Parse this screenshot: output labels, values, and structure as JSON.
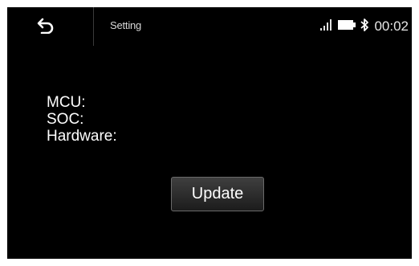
{
  "header": {
    "title": "Setting",
    "back_icon": "back-arrow-icon"
  },
  "status_bar": {
    "signal_icon": "signal-bars-icon",
    "battery_icon": "battery-icon",
    "bluetooth_icon": "bluetooth-icon",
    "time": "00:02"
  },
  "info": {
    "mcu_label": "MCU:",
    "soc_label": "SOC:",
    "hardware_label": "Hardware:"
  },
  "actions": {
    "update_label": "Update"
  },
  "colors": {
    "background": "#000000",
    "text": "#ffffff",
    "button_border": "#6a6a6a"
  }
}
